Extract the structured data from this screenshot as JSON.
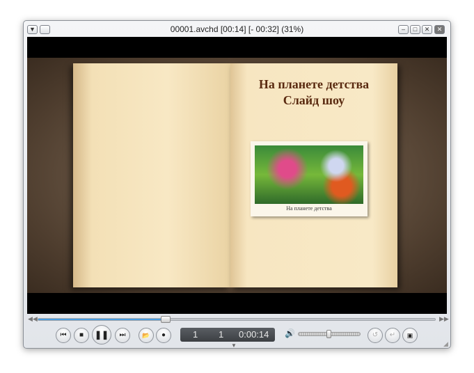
{
  "window": {
    "title": "00001.avchd [00:14] [- 00:32] (31%)"
  },
  "video": {
    "heading_line1": "На планете детства",
    "heading_line2": "Слайд шоу",
    "photo_caption": "На планете детства"
  },
  "playback": {
    "progress_percent": 31,
    "volume_percent": 50,
    "lcd": {
      "title_no": "1",
      "chapter_no": "1",
      "time": "0:00:14"
    }
  },
  "icons": {
    "prev": "⏮",
    "stop": "■",
    "pause": "❚❚",
    "next": "⏭",
    "open": "📂",
    "record": "●",
    "volume": "🔊"
  }
}
